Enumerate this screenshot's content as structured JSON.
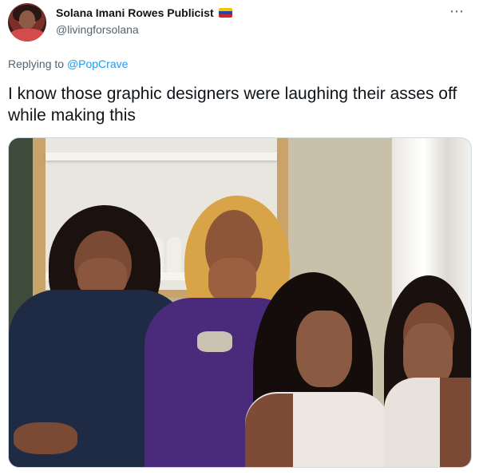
{
  "author": {
    "display_name": "Solana Imani Rowes Publicist",
    "handle": "@livingforsolana",
    "flag_colors": [
      "#f4c400",
      "#1f4aa8",
      "#d6202a"
    ]
  },
  "menu": {
    "more_icon": "⋯"
  },
  "reply": {
    "prefix": "Replying to",
    "mention": "@PopCrave"
  },
  "tweet": {
    "text": "I know those graphic designers were laughing their asses off while making this"
  },
  "colors": {
    "text_primary": "#0f1419",
    "text_secondary": "#536471",
    "link": "#1d9bf0",
    "border": "#cfd9de"
  }
}
